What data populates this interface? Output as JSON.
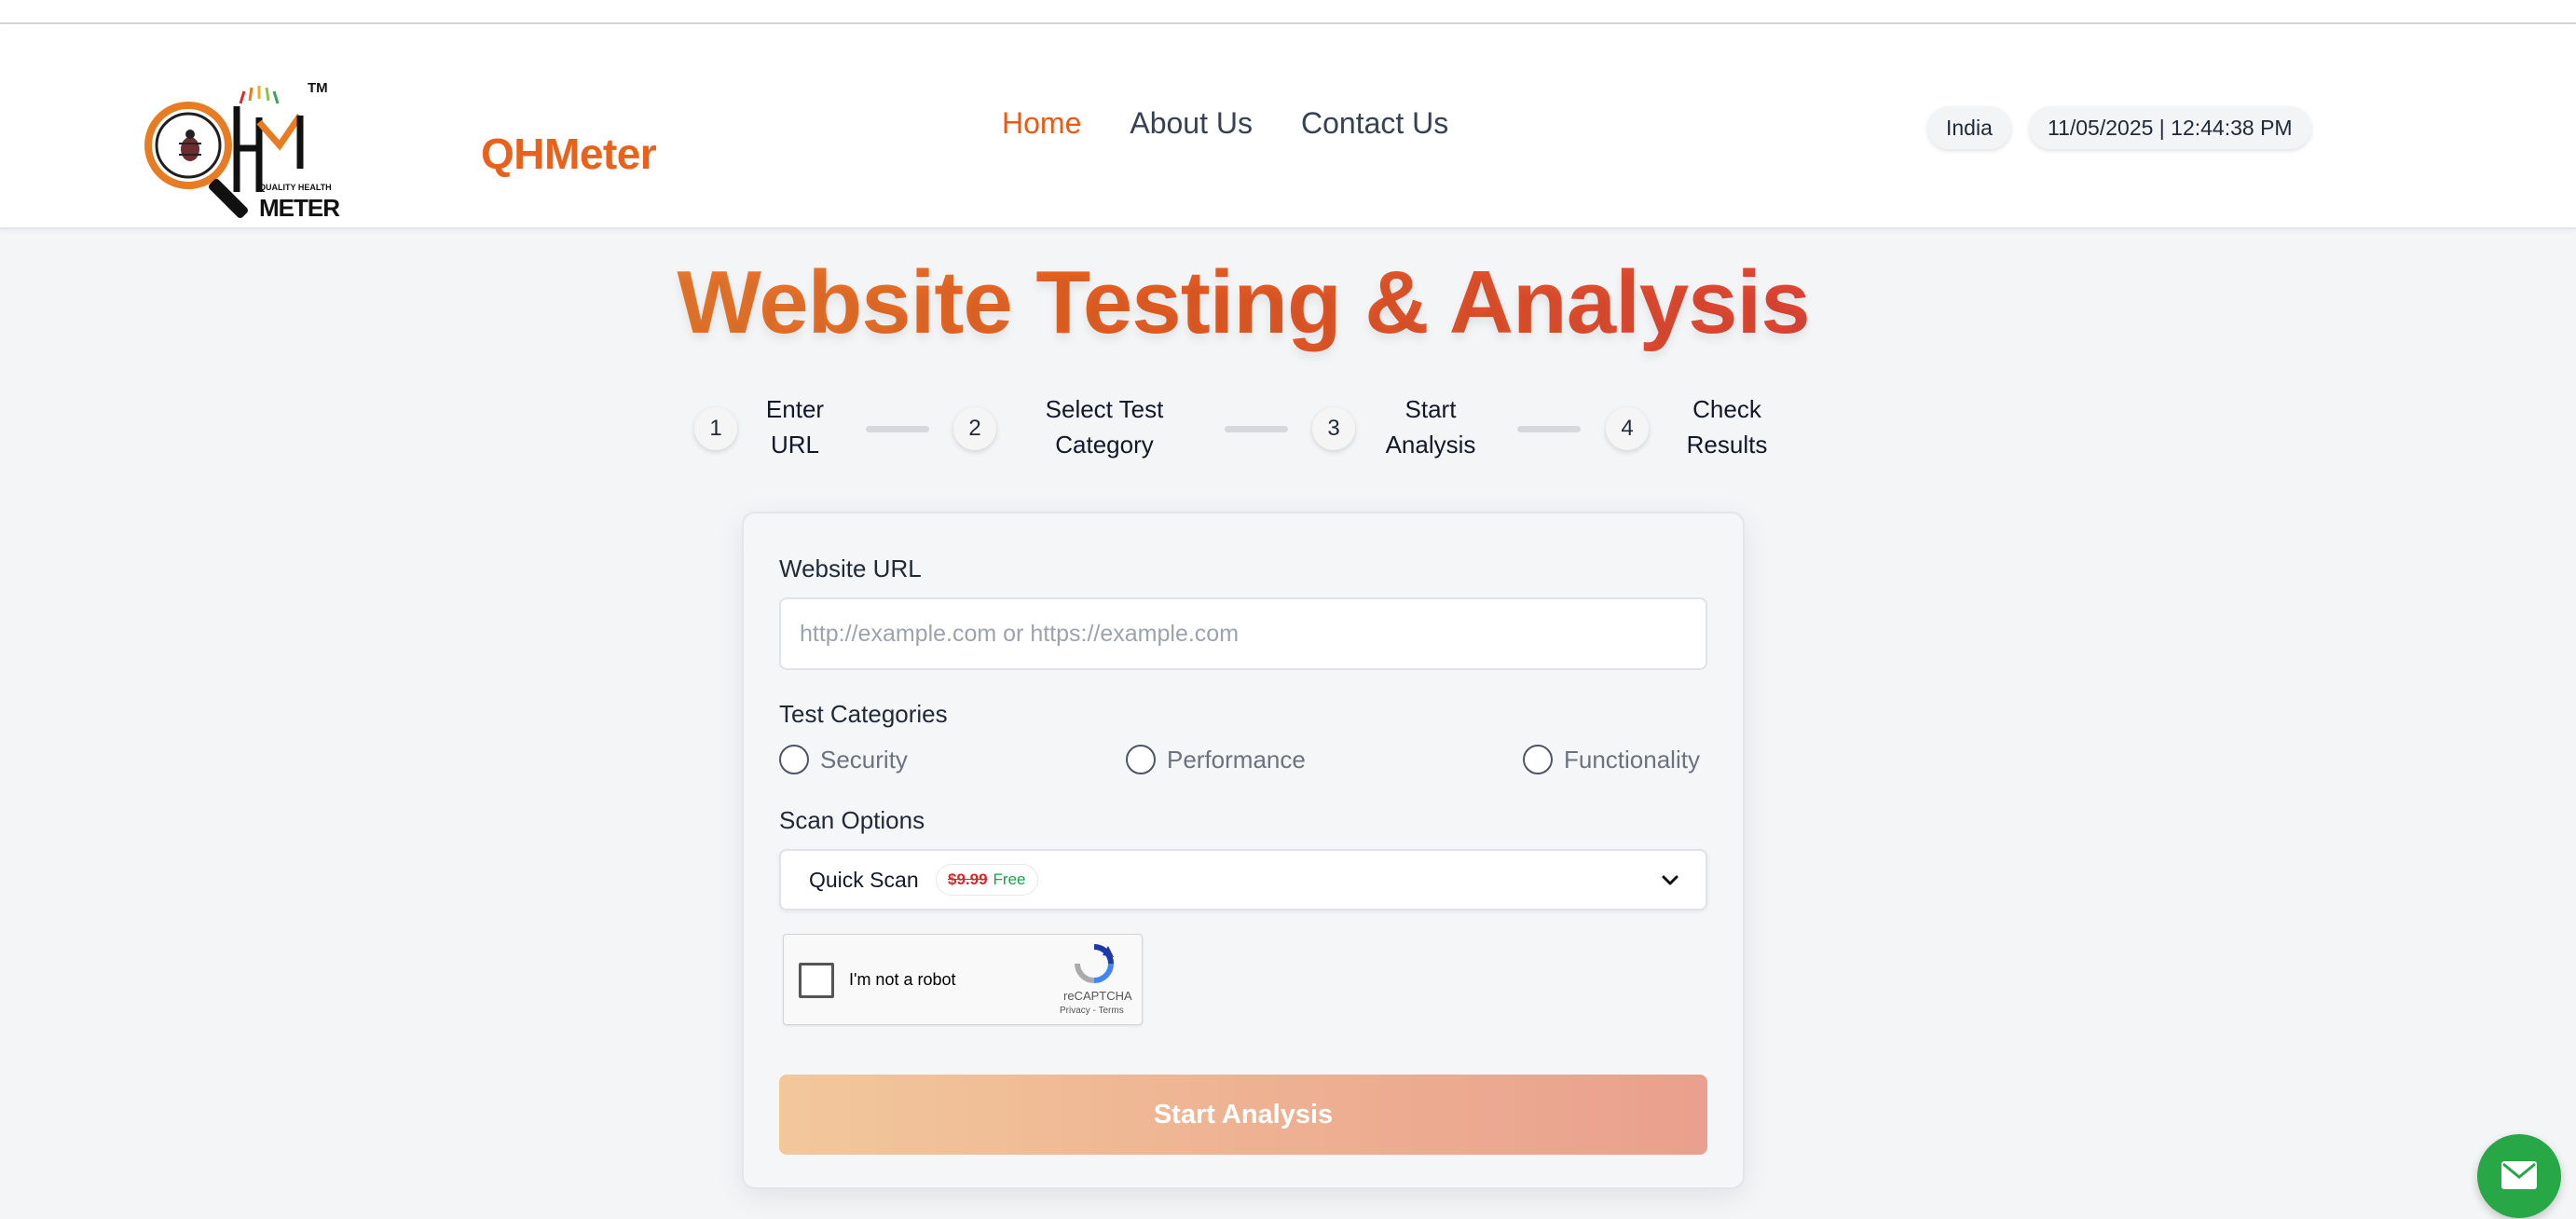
{
  "header": {
    "brand": "QHMeter",
    "logo_text": {
      "trademark": "TM",
      "tagline": "QUALITY HEALTH",
      "word": "METER"
    },
    "nav": [
      {
        "label": "Home",
        "active": true
      },
      {
        "label": "About Us",
        "active": false
      },
      {
        "label": "Contact Us",
        "active": false
      }
    ],
    "country": "India",
    "datetime": "11/05/2025 | 12:44:38 PM"
  },
  "hero": {
    "title": "Website Testing & Analysis"
  },
  "steps": [
    {
      "number": "1",
      "line1": "Enter",
      "line2": "URL"
    },
    {
      "number": "2",
      "line1": "Select Test",
      "line2": "Category"
    },
    {
      "number": "3",
      "line1": "Start",
      "line2": "Analysis"
    },
    {
      "number": "4",
      "line1": "Check",
      "line2": "Results"
    }
  ],
  "form": {
    "url_label": "Website URL",
    "url_value": "",
    "url_placeholder": "http://example.com or https://example.com",
    "categories_label": "Test Categories",
    "categories": [
      {
        "label": "Security",
        "checked": false
      },
      {
        "label": "Performance",
        "checked": false
      },
      {
        "label": "Functionality",
        "checked": false
      }
    ],
    "scan_label": "Scan Options",
    "scan_selected": "Quick Scan",
    "scan_price_old": "$9.99",
    "scan_price_new": "Free",
    "recaptcha": {
      "label": "I'm not a robot",
      "brand": "reCAPTCHA",
      "links": "Privacy - Terms"
    },
    "submit_label": "Start Analysis"
  },
  "colors": {
    "accent": "#ea5a15",
    "fab": "#27a745",
    "gradient_start": "#f0a03c",
    "gradient_end": "#db2d47"
  },
  "icons": {
    "chevron": "chevron-down-icon",
    "mail": "envelope-icon",
    "recaptcha": "recaptcha-logo-icon"
  }
}
